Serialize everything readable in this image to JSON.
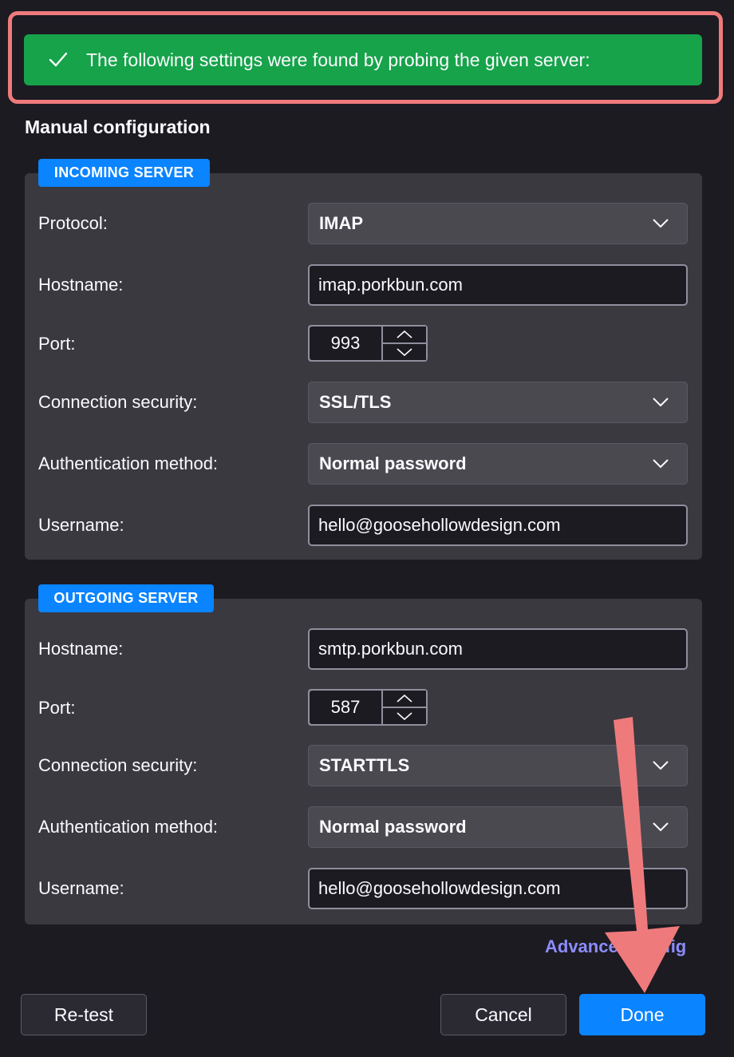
{
  "banner": {
    "icon": "checkmark-icon",
    "message": "The following settings were found by probing the given server:"
  },
  "section_title": "Manual configuration",
  "incoming": {
    "tag": "INCOMING SERVER",
    "protocol_label": "Protocol:",
    "protocol_value": "IMAP",
    "hostname_label": "Hostname:",
    "hostname_value": "imap.porkbun.com",
    "port_label": "Port:",
    "port_value": "993",
    "security_label": "Connection security:",
    "security_value": "SSL/TLS",
    "auth_label": "Authentication method:",
    "auth_value": "Normal password",
    "username_label": "Username:",
    "username_value": "hello@goosehollowdesign.com"
  },
  "outgoing": {
    "tag": "OUTGOING SERVER",
    "hostname_label": "Hostname:",
    "hostname_value": "smtp.porkbun.com",
    "port_label": "Port:",
    "port_value": "587",
    "security_label": "Connection security:",
    "security_value": "STARTTLS",
    "auth_label": "Authentication method:",
    "auth_value": "Normal password",
    "username_label": "Username:",
    "username_value": "hello@goosehollowdesign.com"
  },
  "advanced_link": "Advanced config",
  "buttons": {
    "retest": "Re-test",
    "cancel": "Cancel",
    "done": "Done"
  },
  "colors": {
    "background": "#1c1b22",
    "success_banner": "#16a34a",
    "accent_blue": "#0a84ff",
    "annotation_red": "#ef7a7c",
    "link": "#8c8cff"
  }
}
